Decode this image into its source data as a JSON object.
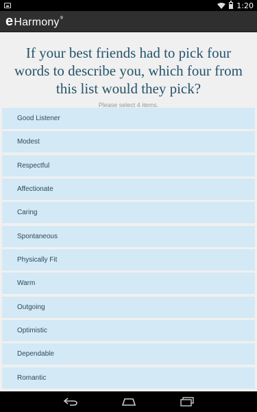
{
  "status_bar": {
    "time": "1:20",
    "icons": [
      "notification-icon",
      "wifi-icon",
      "battery-icon"
    ]
  },
  "app_bar": {
    "logo_e": "e",
    "logo_rest": "Harmony",
    "logo_mark": "®"
  },
  "question": {
    "text": "If your best friends had to pick four words to describe you, which four from this list would they pick?",
    "instruction": "Please select 4 items."
  },
  "options": [
    {
      "label": "Good Listener"
    },
    {
      "label": "Modest"
    },
    {
      "label": "Respectful"
    },
    {
      "label": "Affectionate"
    },
    {
      "label": "Caring"
    },
    {
      "label": "Spontaneous"
    },
    {
      "label": "Physically Fit"
    },
    {
      "label": "Warm"
    },
    {
      "label": "Outgoing"
    },
    {
      "label": "Optimistic"
    },
    {
      "label": "Dependable"
    },
    {
      "label": "Romantic"
    }
  ],
  "nav_bar": {
    "icons": [
      "back-icon",
      "home-icon",
      "recents-icon"
    ]
  },
  "colors": {
    "question_text": "#23536b",
    "option_bg": "#d3e9f5",
    "app_bar_bg": "#2f2f2f"
  }
}
